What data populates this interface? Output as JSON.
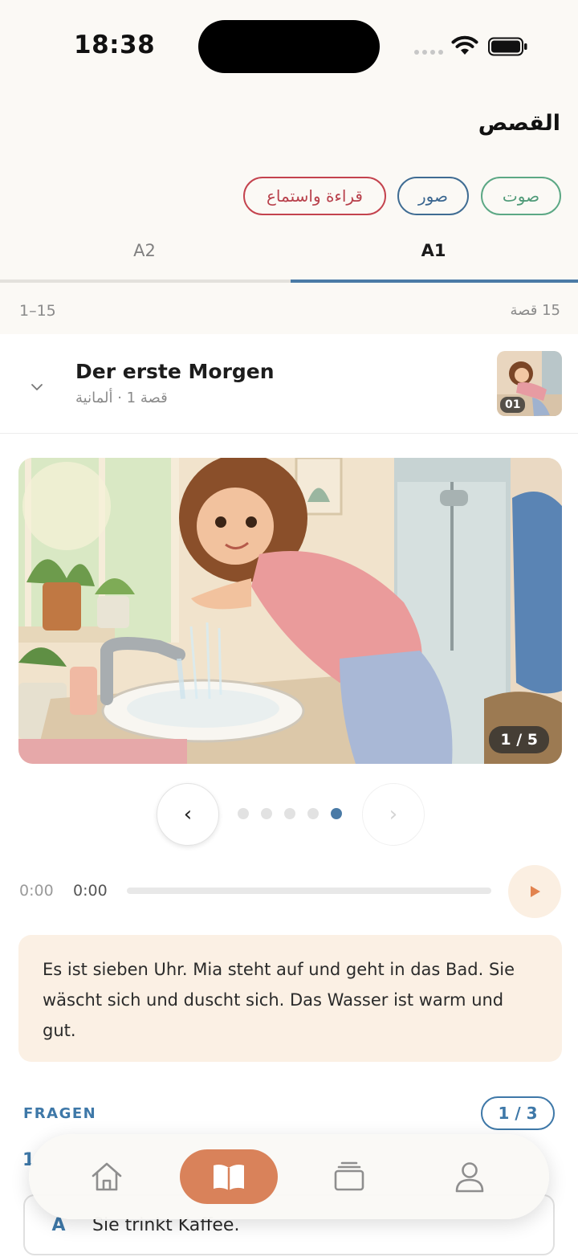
{
  "status_bar": {
    "time": "18:38"
  },
  "header": {
    "title": "القصص"
  },
  "filters": [
    {
      "label": "صوت",
      "color": "#5ca885"
    },
    {
      "label": "صور",
      "color": "#3f6c93"
    },
    {
      "label": "قراءة واستماع",
      "color": "#c4434e"
    }
  ],
  "levels": {
    "tabs": [
      "A2",
      "A1"
    ],
    "active": "A1"
  },
  "list_info": {
    "range": "1–15",
    "count": "15 قصة"
  },
  "story": {
    "title": "Der erste Morgen",
    "subtitle": "قصة 1 · ألمانية",
    "thumb_number": "01",
    "image_counter": "1 / 5",
    "carousel": {
      "total": 5,
      "active_index": 4
    },
    "audio": {
      "time_left": "0:00",
      "time_current": "0:00",
      "progress": 0
    },
    "text": "Es ist sieben Uhr. Mia steht auf und geht in das Bad. Sie wäscht sich und duscht sich. Das Wasser ist warm und gut."
  },
  "questions": {
    "label": "FRAGEN",
    "badge": "1 / 3",
    "number": "1",
    "answer": {
      "letter": "A",
      "text": "Sie trinkt Kaffee."
    }
  },
  "nav": {
    "items": [
      "home",
      "stories",
      "cards",
      "profile"
    ],
    "active": "stories",
    "accent": "#d9825a"
  },
  "colors": {
    "accent_blue": "#4a7aa6",
    "text_box_bg": "#fbf0e4"
  }
}
